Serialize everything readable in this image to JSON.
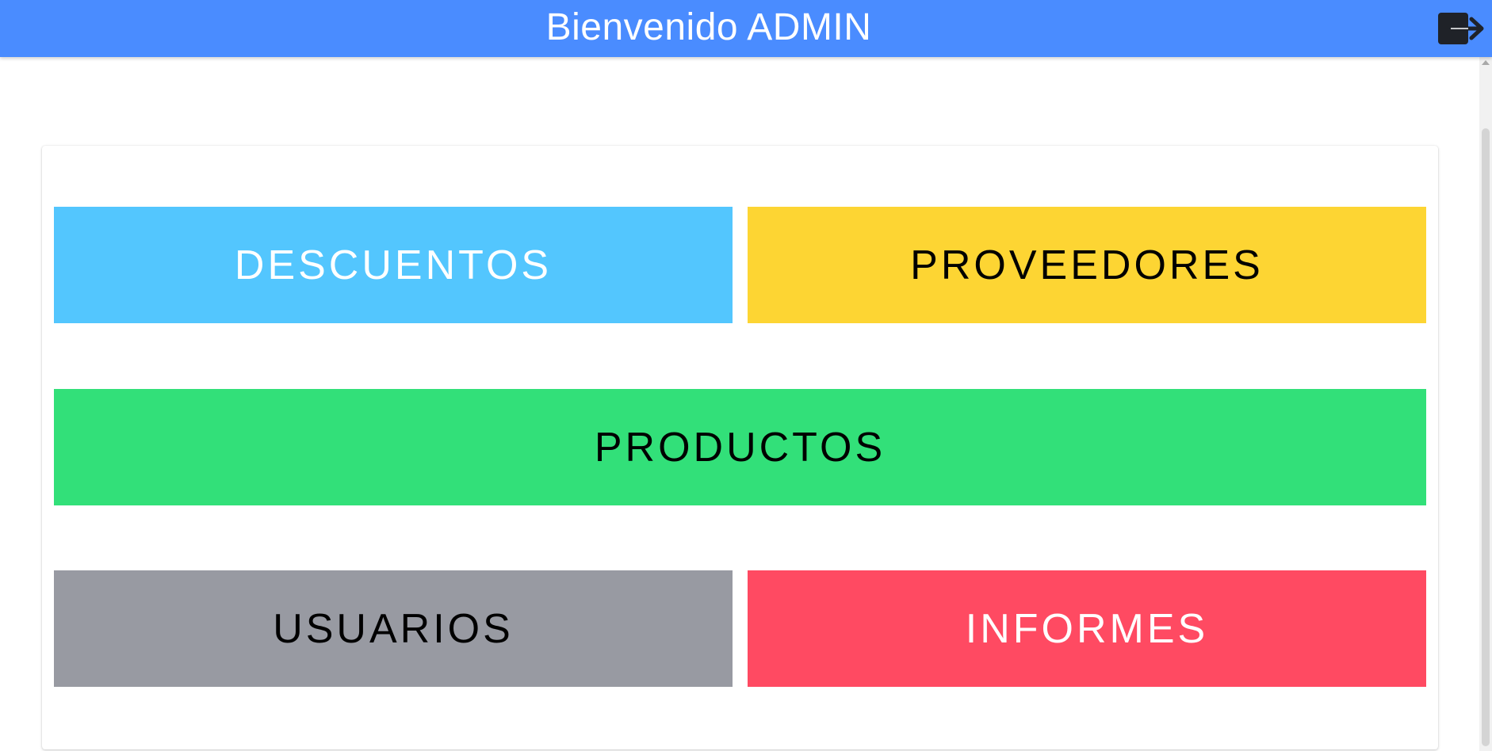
{
  "header": {
    "title": "Bienvenido ADMIN",
    "background_color": "#4a8cff",
    "logout_icon": "logout-icon"
  },
  "menu": {
    "tiles": [
      {
        "label": "DESCUENTOS",
        "color": "#53c6fe",
        "text_color": "#ffffff"
      },
      {
        "label": "PROVEEDORES",
        "color": "#fdd533",
        "text_color": "#000000"
      },
      {
        "label": "PRODUCTOS",
        "color": "#32e079",
        "text_color": "#000000"
      },
      {
        "label": "USUARIOS",
        "color": "#989aa2",
        "text_color": "#000000"
      },
      {
        "label": "INFORMES",
        "color": "#ff4a62",
        "text_color": "#ffffff"
      }
    ]
  }
}
